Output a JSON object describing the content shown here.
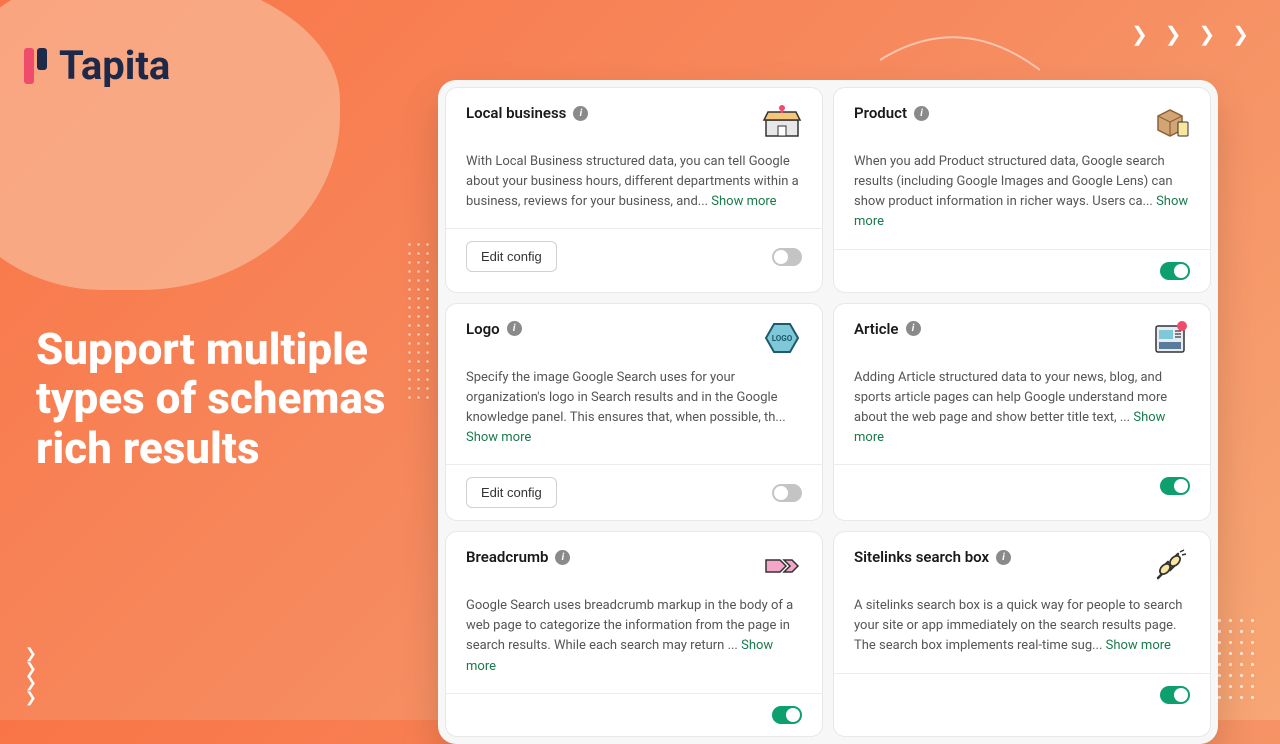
{
  "brand": "Tapita",
  "headline": "Support multiple types of schemas rich results",
  "show_more_label": "Show more",
  "edit_config_label": "Edit config",
  "cards": [
    {
      "title": "Local business",
      "desc": "With Local Business structured data, you can tell Google about your business hours, different departments within a business, reviews for your business, and... ",
      "has_edit": true,
      "enabled": false
    },
    {
      "title": "Product",
      "desc": "When you add Product structured data, Google search results (including Google Images and Google Lens) can show product information in richer ways. Users ca... ",
      "has_edit": false,
      "enabled": true
    },
    {
      "title": "Logo",
      "desc": "Specify the image Google Search uses for your organization's logo in Search results and in the Google knowledge panel. This ensures that, when possible, th... ",
      "has_edit": true,
      "enabled": false
    },
    {
      "title": "Article",
      "desc": "Adding Article structured data to your news, blog, and sports article pages can help Google understand more about the web page and show better title text, ... ",
      "has_edit": false,
      "enabled": true
    },
    {
      "title": "Breadcrumb",
      "desc": "Google Search uses breadcrumb markup in the body of a web page to categorize the information from the page in search results. While each search may return ... ",
      "has_edit": false,
      "enabled": true
    },
    {
      "title": "Sitelinks search box",
      "desc": "A sitelinks search box is a quick way for people to search your site or app immediately on the search results page. The search box implements real-time sug... ",
      "has_edit": false,
      "enabled": true
    }
  ]
}
